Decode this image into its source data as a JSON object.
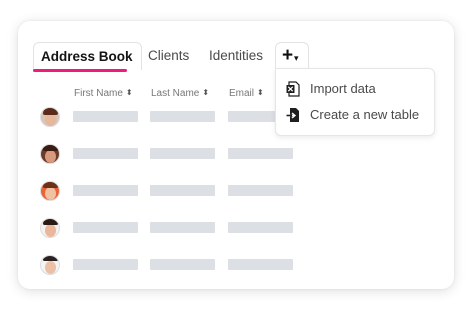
{
  "tabs": {
    "address_book": "Address Book",
    "clients": "Clients",
    "identities": "Identities",
    "add_plus": "+",
    "add_caret": "▾"
  },
  "columns": {
    "first_name": "First Name",
    "last_name": "Last Name",
    "email": "Email",
    "sort_glyph": "⬍"
  },
  "rows": [
    {
      "avatar": "avatar-woman-1"
    },
    {
      "avatar": "avatar-man-1"
    },
    {
      "avatar": "avatar-man-2"
    },
    {
      "avatar": "avatar-man-3"
    },
    {
      "avatar": "avatar-man-4"
    }
  ],
  "menu": {
    "import_data": "Import data",
    "create_table": "Create a new table"
  },
  "colors": {
    "accent": "#ec1e79",
    "placeholder_bar": "#dcdfe3"
  }
}
